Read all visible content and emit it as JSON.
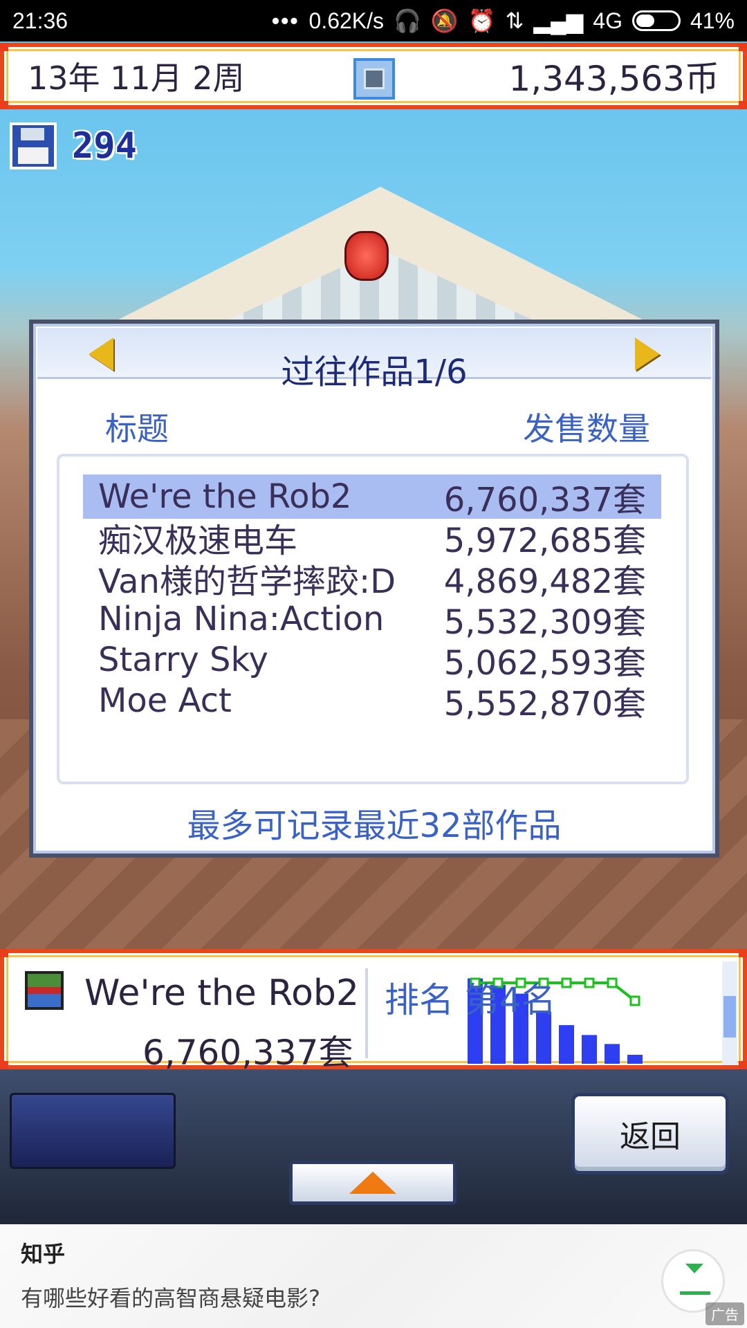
{
  "status_bar": {
    "time": "21:36",
    "dots": "•••",
    "network_speed": "0.62K/s",
    "network_type": "4G",
    "battery": "41%"
  },
  "top_bar": {
    "date": "13年 11月 2周",
    "coins": "1,343,563币"
  },
  "save": {
    "points": "294"
  },
  "dialog": {
    "title": "过往作品1/6",
    "column_title": "标题",
    "column_sales": "发售数量",
    "rows": [
      {
        "name": "We're the Rob2",
        "sales": "6,760,337套",
        "selected": true
      },
      {
        "name": "痴汉极速电车",
        "sales": "5,972,685套",
        "selected": false
      },
      {
        "name": "Van様的哲学摔跤:D",
        "sales": "4,869,482套",
        "selected": false
      },
      {
        "name": "Ninja Nina:Action",
        "sales": "5,532,309套",
        "selected": false
      },
      {
        "name": "Starry Sky",
        "sales": "5,062,593套",
        "selected": false
      },
      {
        "name": "Moe Act",
        "sales": "5,552,870套",
        "selected": false
      }
    ],
    "footer": "最多可记录最近32部作品"
  },
  "info_panel": {
    "game_name": "We're the Rob2",
    "game_sales": "6,760,337套",
    "rank": "排名 第4名"
  },
  "chart_data": {
    "type": "bar",
    "bars": [
      95,
      88,
      78,
      58,
      43,
      32,
      22,
      10
    ],
    "line": [
      90,
      90,
      90,
      90,
      90,
      90,
      90,
      70
    ],
    "bar_color": "#2d3ff0",
    "line_color": "#19c21a"
  },
  "controls": {
    "back_label": "返回"
  },
  "ad": {
    "brand": "知乎",
    "text": "有哪些好看的高智商悬疑电影?",
    "label": "广告"
  },
  "colors": {
    "frame_red": "#e8461b",
    "frame_yellow": "#f8c243",
    "title_blue": "#1d2a78",
    "accent_blue": "#3a62c6",
    "selection": "#a9bdf3"
  }
}
